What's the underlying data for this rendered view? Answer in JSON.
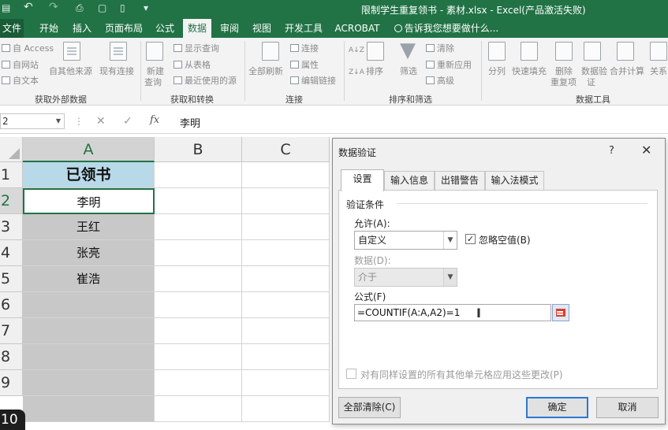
{
  "titlebar": {
    "title": "限制学生重复领书 - 素材.xlsx - Excel(产品激活失败)",
    "quick_access": [
      "▤",
      "↶",
      "↷",
      "⎙",
      "▢",
      "▯",
      "▾"
    ]
  },
  "tabs": [
    {
      "id": "file",
      "label": "文件"
    },
    {
      "id": "home",
      "label": "开始"
    },
    {
      "id": "insert",
      "label": "插入"
    },
    {
      "id": "layout",
      "label": "页面布局"
    },
    {
      "id": "formulas",
      "label": "公式"
    },
    {
      "id": "data",
      "label": "数据"
    },
    {
      "id": "review",
      "label": "审阅"
    },
    {
      "id": "view",
      "label": "视图"
    },
    {
      "id": "developer",
      "label": "开发工具"
    },
    {
      "id": "acrobat",
      "label": "ACROBAT"
    },
    {
      "id": "tellme",
      "label": "告诉我您想要做什么..."
    }
  ],
  "ribbon": {
    "get_external": {
      "label": "获取外部数据",
      "from_access": "自 Access",
      "from_web": "自网站",
      "from_text": "自文本",
      "from_other": "自其他来源",
      "existing": "现有连接"
    },
    "get_transform": {
      "label": "获取和转换",
      "new_query_1": "新建",
      "new_query_2": "查询",
      "show_queries": "显示查询",
      "from_table": "从表格",
      "recent_sources": "最近使用的源"
    },
    "connections": {
      "label": "连接",
      "refresh_all": "全部刷新",
      "connections": "连接",
      "properties": "属性",
      "edit_links": "编辑链接"
    },
    "sort_filter": {
      "label": "排序和筛选",
      "sort": "排序",
      "filter": "筛选",
      "clear": "清除",
      "reapply": "重新应用",
      "advanced": "高级",
      "az": "A↓Z",
      "za": "Z↓A"
    },
    "data_tools": {
      "label": "数据工具",
      "text_to_columns": "分列",
      "flash_fill": "快速填充",
      "remove_dup_1": "删除",
      "remove_dup_2": "重复项",
      "data_validation_1": "数据验",
      "data_validation_2": "证",
      "consolidate": "合并计算",
      "relationships": "关系"
    }
  },
  "formula_bar": {
    "name_box": "2",
    "cancel": "✕",
    "enter": "✓",
    "fx": "fx",
    "content": "李明"
  },
  "sheet": {
    "columns": [
      "A",
      "B",
      "C"
    ],
    "rows": [
      "1",
      "2",
      "3",
      "4",
      "5",
      "6",
      "7",
      "8",
      "9",
      "10"
    ],
    "cells": {
      "A1": "已领书",
      "A2": "李明",
      "A3": "王红",
      "A4": "张亮",
      "A5": "崔浩"
    },
    "header_fill": "#b8d9e8",
    "gray_fill": "#c8c8c8"
  },
  "dialog": {
    "title": "数据验证",
    "help": "?",
    "close": "✕",
    "tabs": [
      "设置",
      "输入信息",
      "出错警告",
      "输入法模式"
    ],
    "section": "验证条件",
    "allow_label": "允许(A):",
    "allow_value": "自定义",
    "ignore_blank": "忽略空值(B)",
    "data_label": "数据(D):",
    "data_value": "介于",
    "formula_label": "公式(F)",
    "formula_value": "=COUNTIF(A:A,A2)=1",
    "apply_all": "对有同样设置的所有其他单元格应用这些更改(P)",
    "clear_all": "全部清除(C)",
    "ok": "确定",
    "cancel": "取消"
  },
  "colors": {
    "excel_green": "#217346",
    "header_blue": "#b8d9e8",
    "gray_cells": "#c8c8c8",
    "accent_button": "#2b78d4"
  }
}
